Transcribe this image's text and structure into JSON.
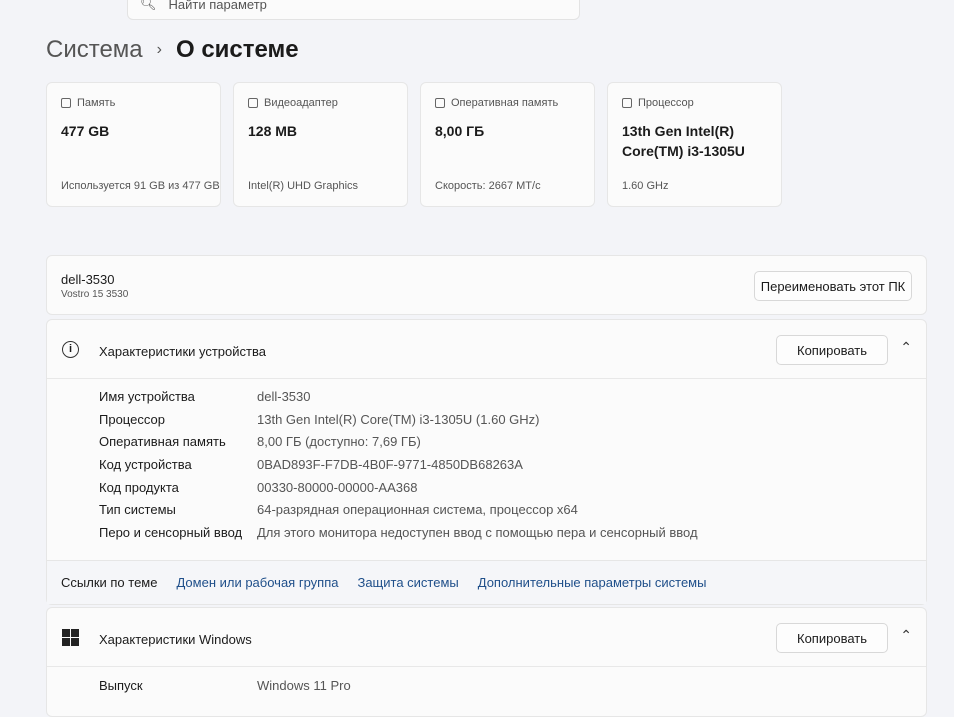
{
  "search": {
    "placeholder": "Найти параметр"
  },
  "breadcrumb": {
    "parent": "Система",
    "current": "О системе"
  },
  "cards": [
    {
      "title": "Память",
      "value": "477 GB",
      "sub": "Используется 91 GB из 477 GB",
      "icon": "storage-icon"
    },
    {
      "title": "Видеоадаптер",
      "value": "128 MB",
      "sub": "Intel(R) UHD Graphics",
      "icon": "gpu-icon"
    },
    {
      "title": "Оперативная память",
      "value": "8,00 ГБ",
      "sub": "Скорость: 2667 МТ/с",
      "icon": "ram-icon"
    },
    {
      "title": "Процессор",
      "value": "13th Gen Intel(R) Core(TM) i3-1305U",
      "sub": "1.60 GHz",
      "icon": "cpu-icon"
    }
  ],
  "device": {
    "name": "dell-3530",
    "model": "Vostro 15 3530",
    "rename_label": "Переименовать этот ПК"
  },
  "device_specs": {
    "title": "Характеристики устройства",
    "copy_label": "Копировать",
    "rows": [
      {
        "k": "Имя устройства",
        "v": "dell-3530"
      },
      {
        "k": "Процессор",
        "v": "13th Gen Intel(R) Core(TM) i3-1305U (1.60 GHz)"
      },
      {
        "k": "Оперативная память",
        "v": "8,00 ГБ (доступно: 7,69 ГБ)"
      },
      {
        "k": "Код устройства",
        "v": "0BAD893F-F7DB-4B0F-9771-4850DB68263A"
      },
      {
        "k": "Код продукта",
        "v": "00330-80000-00000-AA368"
      },
      {
        "k": "Тип системы",
        "v": "64-разрядная операционная система, процессор x64"
      },
      {
        "k": "Перо и сенсорный ввод",
        "v": "Для этого монитора недоступен ввод с помощью пера и сенсорный ввод"
      }
    ]
  },
  "links": {
    "label": "Ссылки по теме",
    "items": [
      "Домен или рабочая группа",
      "Защита системы",
      "Дополнительные параметры системы"
    ]
  },
  "windows_specs": {
    "title": "Характеристики Windows",
    "copy_label": "Копировать",
    "rows": [
      {
        "k": "Выпуск",
        "v": "Windows 11 Pro"
      }
    ]
  }
}
